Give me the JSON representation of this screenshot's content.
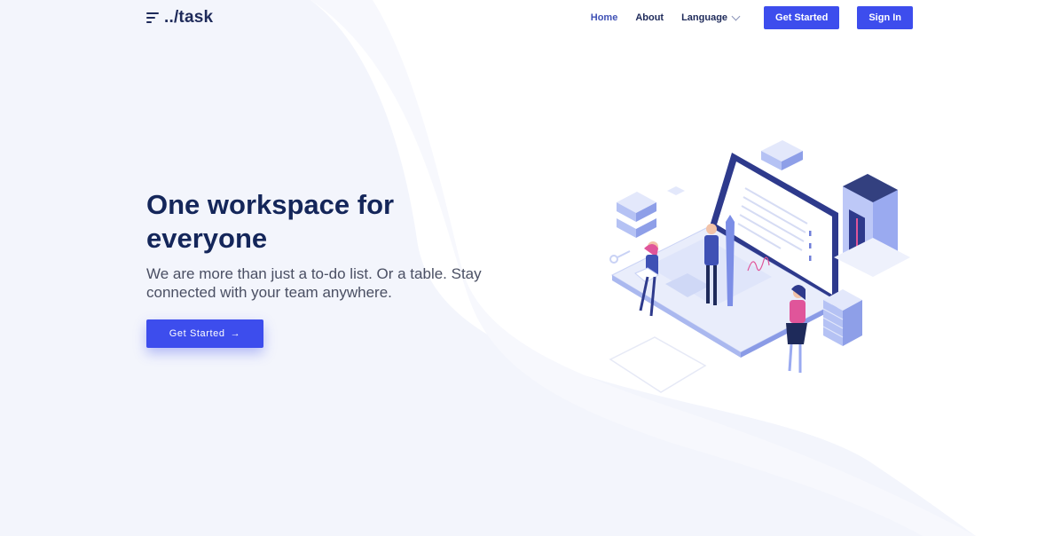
{
  "header": {
    "logo_text": "../task",
    "nav": {
      "home": "Home",
      "about": "About",
      "language": "Language",
      "get_started": "Get Started",
      "sign_in": "Sign In"
    }
  },
  "hero": {
    "title": "One workspace for everyone",
    "subtitle": "We are more than just a to-do list. Or a table. Stay connected with your team anywhere.",
    "cta_label": "Get Started",
    "cta_arrow": "→"
  },
  "colors": {
    "accent": "#3d4ded",
    "heading": "#14265a",
    "background_wave": "#f3f5fc"
  }
}
